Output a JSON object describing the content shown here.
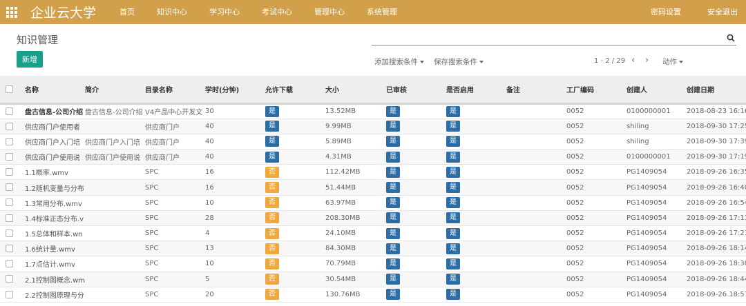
{
  "topbar": {
    "brand": "企业云大学",
    "nav": [
      "首页",
      "知识中心",
      "学习中心",
      "考试中心",
      "管理中心",
      "系统管理"
    ],
    "right": [
      "密码设置",
      "安全退出"
    ],
    "color": "#d2a04a"
  },
  "page": {
    "title": "知识管理",
    "new_button": "新增",
    "search_placeholder": "",
    "add_filter": "添加搜索条件",
    "save_filter": "保存搜索条件",
    "pager": "1 - 2 / 29",
    "action": "动作"
  },
  "table": {
    "headers": [
      "名称",
      "简介",
      "目录名称",
      "学时(分钟)",
      "允许下载",
      "大小",
      "已审核",
      "是否启用",
      "备注",
      "工厂编码",
      "创建人",
      "创建日期"
    ],
    "rows": [
      {
        "name": "盘古信息-公司介绍",
        "intro": "盘古信息-公司介绍",
        "dir": "V4产品中心开发文",
        "hours": "30",
        "download": "是",
        "size": "13.52MB",
        "audited": "是",
        "enabled": "是",
        "note": "",
        "factory": "0052",
        "creator": "0100000001",
        "date": "2018-08-23 16:16"
      },
      {
        "name": "供应商门户使用者",
        "intro": "",
        "dir": "供应商门户",
        "hours": "40",
        "download": "是",
        "size": "9.99MB",
        "audited": "是",
        "enabled": "是",
        "note": "",
        "factory": "0052",
        "creator": "shiling",
        "date": "2018-09-30 17:25"
      },
      {
        "name": "供应商门户入门培",
        "intro": "供应商门户入门培",
        "dir": "供应商门户",
        "hours": "40",
        "download": "是",
        "size": "5.89MB",
        "audited": "是",
        "enabled": "是",
        "note": "",
        "factory": "0052",
        "creator": "shiling",
        "date": "2018-09-30 17:39"
      },
      {
        "name": "供应商门户使用说",
        "intro": "供应商门户使用说",
        "dir": "供应商门户",
        "hours": "40",
        "download": "是",
        "size": "4.31MB",
        "audited": "是",
        "enabled": "是",
        "note": "",
        "factory": "0052",
        "creator": "0100000001",
        "date": "2018-09-30 17:19"
      },
      {
        "name": "1.1概率.wmv",
        "intro": "",
        "dir": "SPC",
        "hours": "16",
        "download": "否",
        "size": "112.42MB",
        "audited": "是",
        "enabled": "是",
        "note": "",
        "factory": "0052",
        "creator": "PG1409054",
        "date": "2018-09-26 16:35"
      },
      {
        "name": "1.2随机变量与分布",
        "intro": "",
        "dir": "SPC",
        "hours": "16",
        "download": "否",
        "size": "51.44MB",
        "audited": "是",
        "enabled": "是",
        "note": "",
        "factory": "0052",
        "creator": "PG1409054",
        "date": "2018-09-26 16:40"
      },
      {
        "name": "1.3常用分布.wmv",
        "intro": "",
        "dir": "SPC",
        "hours": "10",
        "download": "否",
        "size": "63.97MB",
        "audited": "是",
        "enabled": "是",
        "note": "",
        "factory": "0052",
        "creator": "PG1409054",
        "date": "2018-09-26 16:54"
      },
      {
        "name": "1.4标准正态分布.v",
        "intro": "",
        "dir": "SPC",
        "hours": "28",
        "download": "否",
        "size": "208.30MB",
        "audited": "是",
        "enabled": "是",
        "note": "",
        "factory": "0052",
        "creator": "PG1409054",
        "date": "2018-09-26 17:11"
      },
      {
        "name": "1.5总体和样本.wn",
        "intro": "",
        "dir": "SPC",
        "hours": "4",
        "download": "否",
        "size": "24.10MB",
        "audited": "是",
        "enabled": "是",
        "note": "",
        "factory": "0052",
        "creator": "PG1409054",
        "date": "2018-09-26 17:21"
      },
      {
        "name": "1.6统计量.wmv",
        "intro": "",
        "dir": "SPC",
        "hours": "13",
        "download": "否",
        "size": "84.30MB",
        "audited": "是",
        "enabled": "是",
        "note": "",
        "factory": "0052",
        "creator": "PG1409054",
        "date": "2018-09-26 18:14"
      },
      {
        "name": "1.7点估计.wmv",
        "intro": "",
        "dir": "SPC",
        "hours": "10",
        "download": "否",
        "size": "70.79MB",
        "audited": "是",
        "enabled": "是",
        "note": "",
        "factory": "0052",
        "creator": "PG1409054",
        "date": "2018-09-26 18:38"
      },
      {
        "name": "2.1控制图概念.wm",
        "intro": "",
        "dir": "SPC",
        "hours": "5",
        "download": "否",
        "size": "30.54MB",
        "audited": "是",
        "enabled": "是",
        "note": "",
        "factory": "0052",
        "creator": "PG1409054",
        "date": "2018-09-26 18:44"
      },
      {
        "name": "2.2控制图原理与分",
        "intro": "",
        "dir": "SPC",
        "hours": "20",
        "download": "否",
        "size": "130.76MB",
        "audited": "是",
        "enabled": "是",
        "note": "",
        "factory": "0052",
        "creator": "PG1409054",
        "date": "2018-09-26 18:57"
      }
    ]
  },
  "colors": {
    "yes": "#2c6da6",
    "no": "#efa73e",
    "primary": "#18a089"
  }
}
